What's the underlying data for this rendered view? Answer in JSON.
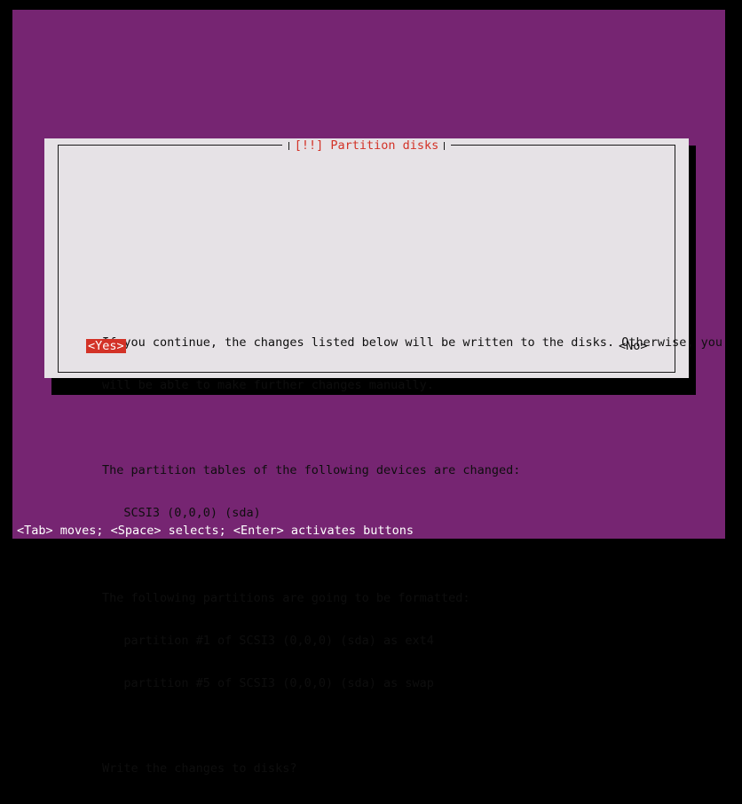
{
  "screen": {
    "background_color": "#000000",
    "console_background_color": "#762572"
  },
  "dialog": {
    "title": "[!!] Partition disks",
    "title_color": "#d33227",
    "background_color": "#e6e2e6",
    "text_color": "#0e0e0e",
    "border_color": "#1a1a1a",
    "lines": [
      "If you continue, the changes listed below will be written to the disks. Otherwise, you",
      "will be able to make further changes manually.",
      "",
      "The partition tables of the following devices are changed:",
      "   SCSI3 (0,0,0) (sda)",
      "",
      "The following partitions are going to be formatted:",
      "   partition #1 of SCSI3 (0,0,0) (sda) as ext4",
      "   partition #5 of SCSI3 (0,0,0) (sda) as swap",
      "",
      "Write the changes to disks?"
    ],
    "buttons": {
      "yes": {
        "label": "<Yes>",
        "selected": "true",
        "highlight_color": "#d33227",
        "highlight_text_color": "#ffffff"
      },
      "no": {
        "label": "<No>",
        "selected": "false"
      }
    }
  },
  "statusbar": {
    "text": "<Tab> moves; <Space> selects; <Enter> activates buttons",
    "background_color": "#762572",
    "text_color": "#ffffff"
  }
}
